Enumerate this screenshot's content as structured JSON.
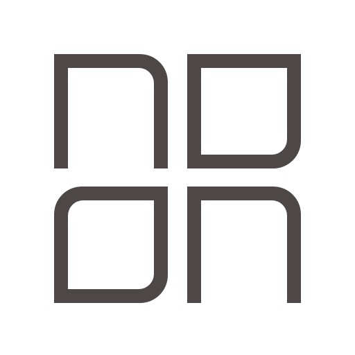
{
  "logo": {
    "icon": "four-quadrant-logo-icon",
    "color": "#4e4748",
    "background": "#ffffff"
  }
}
